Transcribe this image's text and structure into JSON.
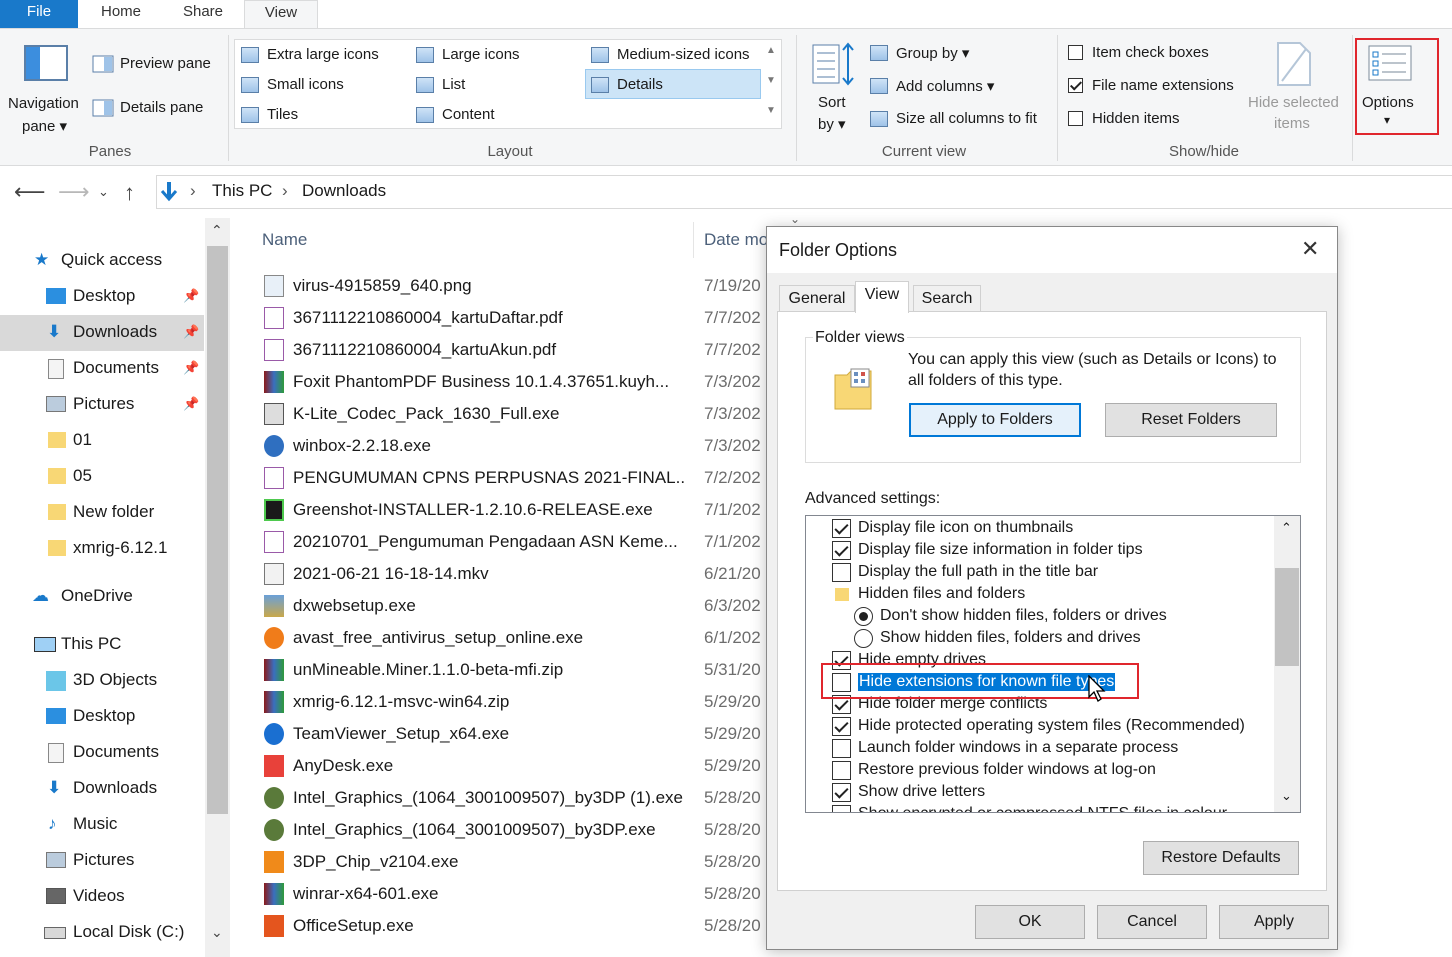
{
  "ribbon": {
    "tabs": {
      "file": "File",
      "home": "Home",
      "share": "Share",
      "view": "View"
    },
    "panes": {
      "navigation_pane": "Navigation",
      "navigation_pane_2": "pane",
      "preview_pane": "Preview pane",
      "details_pane": "Details pane",
      "group_label": "Panes"
    },
    "layout": {
      "items": [
        "Extra large icons",
        "Large icons",
        "Medium-sized icons",
        "Small icons",
        "List",
        "Details",
        "Tiles",
        "Content"
      ],
      "selected": "Details",
      "group_label": "Layout"
    },
    "current_view": {
      "sort_by": "Sort",
      "sort_by_2": "by",
      "group_by": "Group by",
      "add_columns": "Add columns",
      "size_all_columns": "Size all columns to fit",
      "group_label": "Current view"
    },
    "show_hide": {
      "item_check_boxes": "Item check boxes",
      "file_name_extensions": "File name extensions",
      "hidden_items": "Hidden items",
      "hide_selected": "Hide selected",
      "hide_selected_2": "items",
      "group_label": "Show/hide"
    },
    "options": "Options"
  },
  "address": {
    "crumbs": [
      "This PC",
      "Downloads"
    ]
  },
  "nav": {
    "quick_access": "Quick access",
    "quick_items": [
      "Desktop",
      "Downloads",
      "Documents",
      "Pictures",
      "01",
      "05",
      "New folder",
      "xmrig-6.12.1"
    ],
    "onedrive": "OneDrive",
    "this_pc": "This PC",
    "pc_items": [
      "3D Objects",
      "Desktop",
      "Documents",
      "Downloads",
      "Music",
      "Pictures",
      "Videos",
      "Local Disk (C:)"
    ]
  },
  "filelist": {
    "col_name": "Name",
    "col_date": "Date mo",
    "files": [
      {
        "name": "virus-4915859_640.png",
        "date": "7/19/20"
      },
      {
        "name": "3671112210860004_kartuDaftar.pdf",
        "date": "7/7/202"
      },
      {
        "name": "3671112210860004_kartuAkun.pdf",
        "date": "7/7/202"
      },
      {
        "name": "Foxit PhantomPDF Business 10.1.4.37651.kuyh...",
        "date": "7/3/202"
      },
      {
        "name": "K-Lite_Codec_Pack_1630_Full.exe",
        "date": "7/3/202"
      },
      {
        "name": "winbox-2.2.18.exe",
        "date": "7/3/202"
      },
      {
        "name": "PENGUMUMAN CPNS PERPUSNAS 2021-FINAL...",
        "date": "7/2/202"
      },
      {
        "name": "Greenshot-INSTALLER-1.2.10.6-RELEASE.exe",
        "date": "7/1/202"
      },
      {
        "name": "20210701_Pengumuman Pengadaan ASN Keme...",
        "date": "7/1/202"
      },
      {
        "name": "2021-06-21 16-18-14.mkv",
        "date": "6/21/20"
      },
      {
        "name": "dxwebsetup.exe",
        "date": "6/3/202"
      },
      {
        "name": "avast_free_antivirus_setup_online.exe",
        "date": "6/1/202"
      },
      {
        "name": "unMineable.Miner.1.1.0-beta-mfi.zip",
        "date": "5/31/20"
      },
      {
        "name": "xmrig-6.12.1-msvc-win64.zip",
        "date": "5/29/20"
      },
      {
        "name": "TeamViewer_Setup_x64.exe",
        "date": "5/29/20"
      },
      {
        "name": "AnyDesk.exe",
        "date": "5/29/20"
      },
      {
        "name": "Intel_Graphics_(1064_3001009507)_by3DP (1).exe",
        "date": "5/28/20"
      },
      {
        "name": "Intel_Graphics_(1064_3001009507)_by3DP.exe",
        "date": "5/28/20"
      },
      {
        "name": "3DP_Chip_v2104.exe",
        "date": "5/28/20"
      },
      {
        "name": "winrar-x64-601.exe",
        "date": "5/28/20"
      },
      {
        "name": "OfficeSetup.exe",
        "date": "5/28/20"
      }
    ]
  },
  "dialog": {
    "title": "Folder Options",
    "tabs": [
      "General",
      "View",
      "Search"
    ],
    "active_tab": "View",
    "folder_views": {
      "title": "Folder views",
      "desc": "You can apply this view (such as Details or Icons) to all folders of this type.",
      "apply_to_folders": "Apply to Folders",
      "reset_folders": "Reset Folders"
    },
    "advanced_label": "Advanced settings:",
    "settings": [
      {
        "label": "Display file icon on thumbnails",
        "kind": "checkbox",
        "checked": true
      },
      {
        "label": "Display file size information in folder tips",
        "kind": "checkbox",
        "checked": true
      },
      {
        "label": "Display the full path in the title bar",
        "kind": "checkbox",
        "checked": false
      },
      {
        "label": "Hidden files and folders",
        "kind": "folder"
      },
      {
        "label": "Don't show hidden files, folders or drives",
        "kind": "radio",
        "checked": true
      },
      {
        "label": "Show hidden files, folders and drives",
        "kind": "radio",
        "checked": false
      },
      {
        "label": "Hide empty drives",
        "kind": "checkbox",
        "checked": true
      },
      {
        "label": "Hide extensions for known file types",
        "kind": "checkbox",
        "checked": false,
        "highlighted": true
      },
      {
        "label": "Hide folder merge conflicts",
        "kind": "checkbox",
        "checked": true
      },
      {
        "label": "Hide protected operating system files (Recommended)",
        "kind": "checkbox",
        "checked": true
      },
      {
        "label": "Launch folder windows in a separate process",
        "kind": "checkbox",
        "checked": false
      },
      {
        "label": "Restore previous folder windows at log-on",
        "kind": "checkbox",
        "checked": false
      },
      {
        "label": "Show drive letters",
        "kind": "checkbox",
        "checked": true
      },
      {
        "label": "Show encrypted or compressed NTFS files in colour",
        "kind": "checkbox",
        "checked": false
      }
    ],
    "restore_defaults": "Restore Defaults",
    "ok": "OK",
    "cancel": "Cancel",
    "apply": "Apply"
  },
  "colors": {
    "accent": "#1979ca",
    "highlight_box": "#e0262d",
    "selection": "#0078d7"
  }
}
